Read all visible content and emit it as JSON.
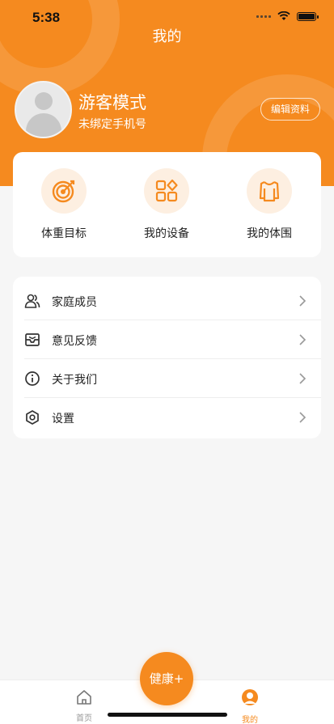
{
  "status": {
    "time": "5:38"
  },
  "header": {
    "title": "我的",
    "user_name": "游客模式",
    "user_sub": "未绑定手机号",
    "edit_label": "编辑资料"
  },
  "quick": [
    {
      "label": "体重目标",
      "icon": "target-icon"
    },
    {
      "label": "我的设备",
      "icon": "devices-grid-icon"
    },
    {
      "label": "我的体围",
      "icon": "body-shirt-icon"
    }
  ],
  "menu": [
    {
      "label": "家庭成员",
      "icon": "family-icon"
    },
    {
      "label": "意见反馈",
      "icon": "feedback-mail-icon"
    },
    {
      "label": "关于我们",
      "icon": "info-icon"
    },
    {
      "label": "设置",
      "icon": "settings-hex-icon"
    }
  ],
  "tabs": {
    "home": "首页",
    "center": "健康+",
    "mine": "我的"
  },
  "colors": {
    "accent": "#f58a1f",
    "accent_light": "#fdefe1"
  }
}
